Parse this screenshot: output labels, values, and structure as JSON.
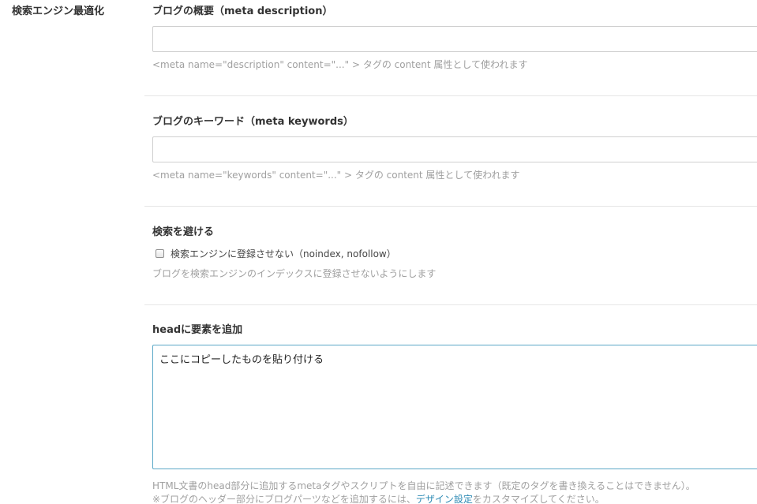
{
  "section": {
    "label": "検索エンジン最適化"
  },
  "description": {
    "title": "ブログの概要（meta description）",
    "value": "",
    "help": "<meta name=\"description\" content=\"...\" > タグの content 属性として使われます"
  },
  "keywords": {
    "title": "ブログのキーワード（meta keywords）",
    "value": "",
    "help": "<meta name=\"keywords\" content=\"...\" > タグの content 属性として使われます"
  },
  "noindex": {
    "title": "検索を避ける",
    "checkbox_label": "検索エンジンに登録させない（noindex, nofollow）",
    "checked": false,
    "help": "ブログを検索エンジンのインデックスに登録させないようにします"
  },
  "head_append": {
    "title": "headに要素を追加",
    "value": "ここにコピーしたものを貼り付ける",
    "help_line1": "HTML文書のhead部分に追加するmetaタグやスクリプトを自由に記述できます（既定のタグを書き換えることはできません）。",
    "help_line2_prefix": "※ブログのヘッダー部分にブログパーツなどを追加するには、",
    "help_line2_link": "デザイン設定",
    "help_line2_suffix": "をカスタマイズしてください。"
  },
  "colors": {
    "link": "#2e8bb5",
    "focus_border": "#5ba8c7",
    "help_text": "#a0a0a0"
  }
}
